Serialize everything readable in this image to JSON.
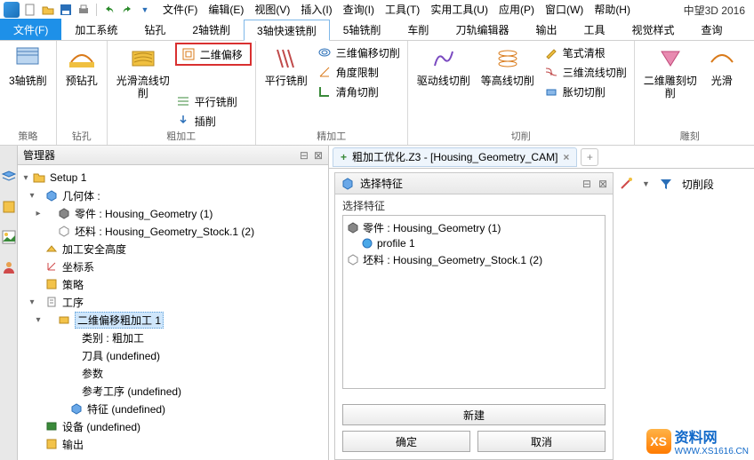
{
  "brand": "中望3D 2016",
  "menus": [
    "文件(F)",
    "编辑(E)",
    "视图(V)",
    "插入(I)",
    "查询(I)",
    "工具(T)",
    "实用工具(U)",
    "应用(P)",
    "窗口(W)",
    "帮助(H)"
  ],
  "tabs": {
    "file": "文件(F)",
    "items": [
      "加工系统",
      "钻孔",
      "2轴铣削",
      "3轴快速铣削",
      "5轴铣削",
      "车削",
      "刀轨编辑器",
      "输出",
      "工具",
      "视觉样式",
      "查询"
    ],
    "activeIndex": 3
  },
  "ribbon": {
    "g1": {
      "label": "策略",
      "b1": "3轴铣削"
    },
    "g2": {
      "label": "钻孔",
      "b1": "预钻孔"
    },
    "g3": {
      "label": "粗加工",
      "b1": "光滑流线切削",
      "s1": "二维偏移",
      "s2": "平行铣削",
      "s3": "插削"
    },
    "g4": {
      "label": "精加工",
      "b1": "平行铣削",
      "s1": "三维偏移切削",
      "s2": "角度限制",
      "s3": "清角切削"
    },
    "g5": {
      "label": "切削",
      "b1": "驱动线切削",
      "b2": "等高线切削",
      "s1": "笔式清根",
      "s2": "三维流线切削",
      "s3": "胀切切削"
    },
    "g6": {
      "label": "雕刻",
      "b1": "二维雕刻切削",
      "b2": "光滑"
    }
  },
  "manager": {
    "title": "管理器"
  },
  "tree": {
    "setup": "Setup 1",
    "geom": "几何体 :",
    "part": "零件 : Housing_Geometry (1)",
    "stock": "坯料 : Housing_Geometry_Stock.1 (2)",
    "safe": "加工安全高度",
    "csys": "坐标系",
    "strategy": "策略",
    "ops": "工序",
    "op1": "二维偏移粗加工 1",
    "cat": "类别 : 粗加工",
    "tool": "刀具 (undefined)",
    "param": "参数",
    "ref": "参考工序 (undefined)",
    "feat": "特征 (undefined)",
    "device": "设备 (undefined)",
    "output": "输出"
  },
  "doc": {
    "title": "粗加工优化.Z3 - [Housing_Geometry_CAM]"
  },
  "dialog": {
    "title": "选择特征",
    "section": "选择特征",
    "r1": "零件 : Housing_Geometry (1)",
    "r2": "profile 1",
    "r3": "坯料 : Housing_Geometry_Stock.1 (2)",
    "new": "新建",
    "ok": "确定",
    "cancel": "取消"
  },
  "side": {
    "label": "切削段"
  },
  "wm": {
    "t1": "资料网",
    "t2": "WWW.XS1616.CN"
  }
}
